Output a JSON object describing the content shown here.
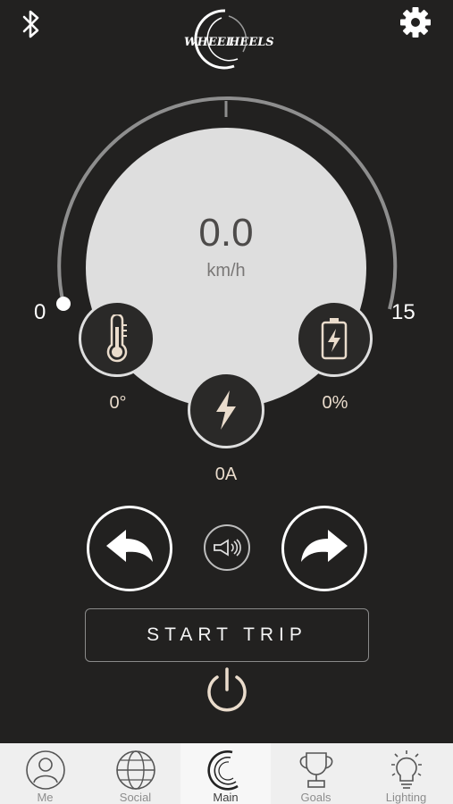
{
  "header": {
    "bluetooth_icon": "bluetooth-icon",
    "logo_text_1": "WHEEL",
    "logo_text_2": "HEELS",
    "settings_icon": "gear-icon"
  },
  "gauge": {
    "speed": "0.0",
    "unit": "km/h",
    "scale_min": "0",
    "scale_max": "15",
    "speed_fraction": 0
  },
  "stats": {
    "temperature": {
      "icon": "thermometer-icon",
      "value": "0°"
    },
    "battery": {
      "icon": "battery-charging-icon",
      "value": "0%"
    },
    "current": {
      "icon": "lightning-bolt-icon",
      "value": "0A"
    }
  },
  "controls": {
    "left_icon": "turn-left-arrow-icon",
    "horn_icon": "horn-icon",
    "right_icon": "turn-right-arrow-icon",
    "start_label": "START TRIP",
    "power_icon": "power-icon"
  },
  "tabs": [
    {
      "label": "Me",
      "icon": "person-icon",
      "active": false
    },
    {
      "label": "Social",
      "icon": "globe-icon",
      "active": false
    },
    {
      "label": "Main",
      "icon": "main-swirl-icon",
      "active": true
    },
    {
      "label": "Goals",
      "icon": "trophy-icon",
      "active": false
    },
    {
      "label": "Lighting",
      "icon": "lightbulb-icon",
      "active": false
    }
  ],
  "colors": {
    "background": "#222120",
    "dial": "#dedede",
    "accent": "#eadccc"
  }
}
